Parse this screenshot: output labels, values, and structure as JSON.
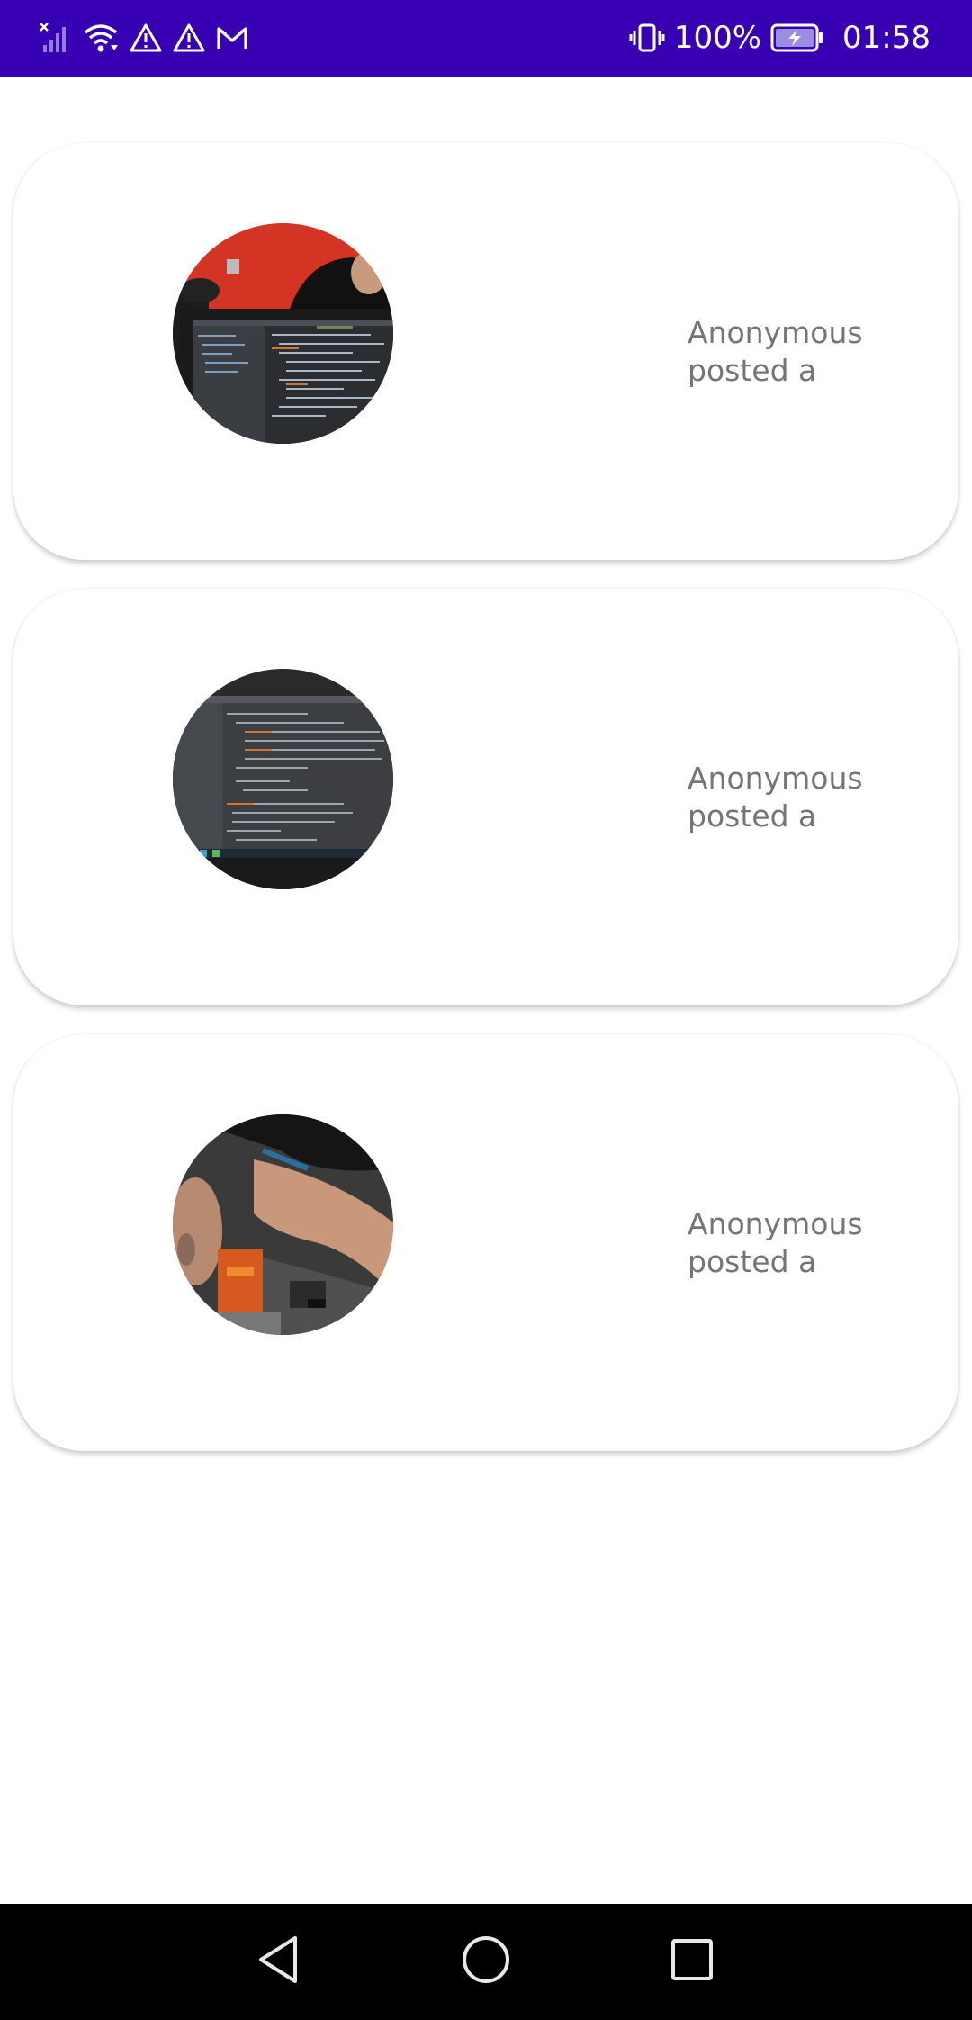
{
  "status_bar": {
    "battery_percent": "100%",
    "time": "01:58",
    "left_icons": [
      "no-signal-icon",
      "wifi-icon",
      "alert-icon",
      "alert-icon",
      "gmail-icon"
    ],
    "right_icons": [
      "vibrate-icon",
      "battery-charging-icon"
    ],
    "background": "#3700B3"
  },
  "feed": {
    "posts": [
      {
        "author_line": "Anonymous",
        "action_line": "posted a",
        "image": "photo-people-at-laptop"
      },
      {
        "author_line": "Anonymous",
        "action_line": "posted a",
        "image": "photo-laptop-code-screen"
      },
      {
        "author_line": "Anonymous",
        "action_line": "posted a",
        "image": "photo-person-rotated"
      }
    ]
  },
  "nav_bar": {
    "buttons": [
      "back-icon",
      "home-icon",
      "recents-icon"
    ]
  },
  "colors": {
    "accent": "#3700B3",
    "card_text": "#757575",
    "nav_background": "#000000"
  }
}
